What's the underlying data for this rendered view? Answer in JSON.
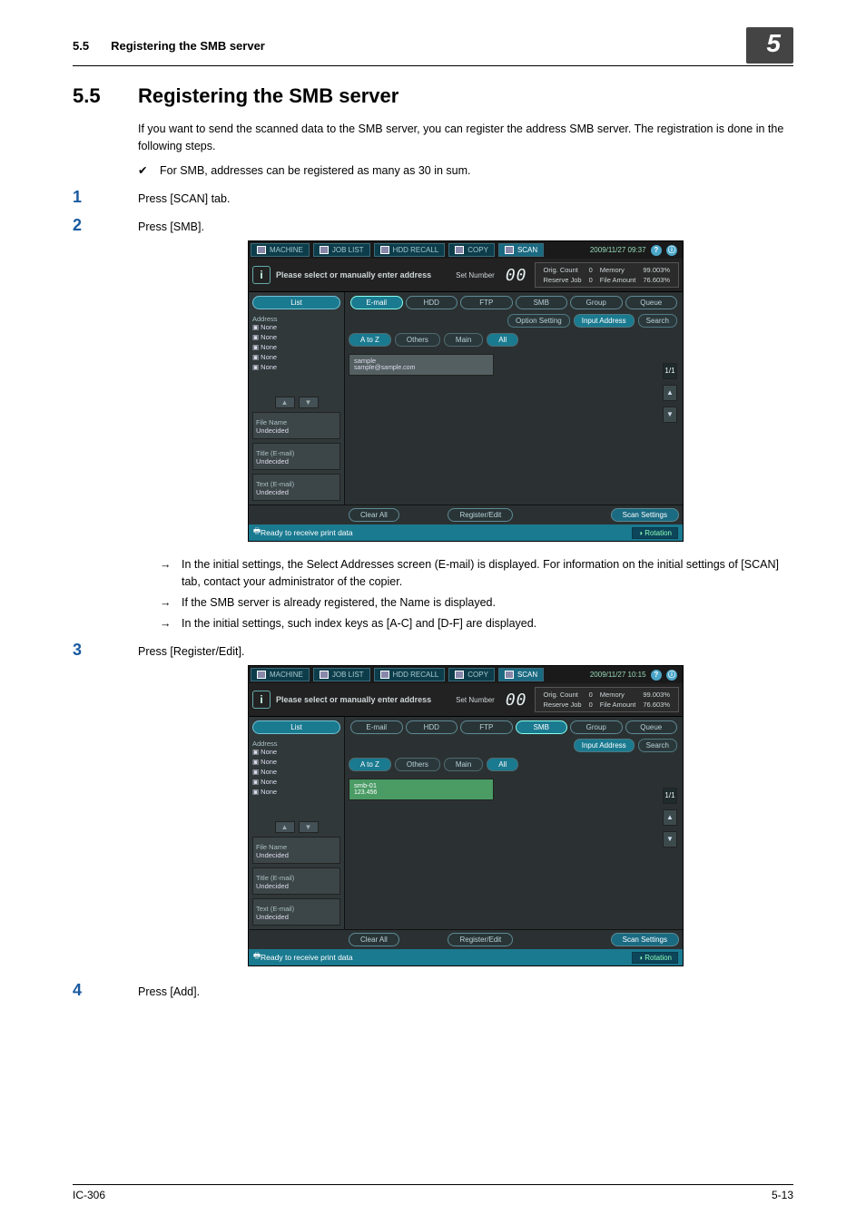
{
  "header": {
    "section_num": "5.5",
    "section_title": "Registering the SMB server",
    "chapter": "5"
  },
  "title": {
    "num": "5.5",
    "text": "Registering the SMB server"
  },
  "intro": "If you want to send the scanned data to the SMB server, you can register the address SMB server.  The registration is done in the following steps.",
  "check1": "For SMB, addresses can be registered as many as 30 in sum.",
  "steps": {
    "1": "Press [SCAN] tab.",
    "2": "Press [SMB].",
    "3": "Press [Register/Edit].",
    "4": "Press [Add]."
  },
  "notes2": {
    "a": "In the initial settings, the Select Addresses screen (E-mail) is displayed.  For information on the initial settings of [SCAN] tab, contact your administrator of the copier.",
    "b": "If the SMB server is already registered, the Name is displayed.",
    "c": "In the initial settings, such index keys as [A-C] and [D-F] are displayed."
  },
  "scr_common": {
    "tab_machine": "MACHINE",
    "tab_joblist": "JOB LIST",
    "tab_hddrecall": "HDD RECALL",
    "tab_copy": "COPY",
    "tab_scan": "SCAN",
    "msg": "Please select or manually enter address",
    "setnumber": "Set Number",
    "bignum": "00",
    "orig_count": "Orig. Count",
    "reserve_job": "Reserve Job",
    "c_zero": "0",
    "memory": "Memory",
    "mem_pct": "99.003%",
    "file_amount": "File Amount",
    "file_pct": "76.603%",
    "left_list": "List",
    "addr_label": "Address",
    "none": "None",
    "file_name": "File Name",
    "undecided": "Undecided",
    "title_email": "Title (E-mail)",
    "text_email": "Text (E-mail)",
    "tabs": {
      "email": "E-mail",
      "hdd": "HDD",
      "ftp": "FTP",
      "smb": "SMB",
      "group": "Group",
      "queue": "Queue"
    },
    "cmd": {
      "option": "Option Setting",
      "input": "Input Address",
      "search": "Search"
    },
    "idx": {
      "atoz": "A to Z",
      "others": "Others",
      "main": "Main",
      "all": "All"
    },
    "scroll_frac": "1",
    "scroll_frac2": "1",
    "clear_all": "Clear All",
    "register_edit": "Register/Edit",
    "scan_settings": "Scan Settings",
    "status_ready": "Ready to receive print data",
    "rotation": "Rotation"
  },
  "scrA": {
    "datetime": "2009/11/27 09:37",
    "entry_name": "sample",
    "entry_sub": "sample@sample.com"
  },
  "scrB": {
    "datetime": "2009/11/27 10:15",
    "entry_name": "smb-01",
    "entry_sub": "123.456"
  },
  "footer": {
    "left": "IC-306",
    "right": "5-13"
  }
}
